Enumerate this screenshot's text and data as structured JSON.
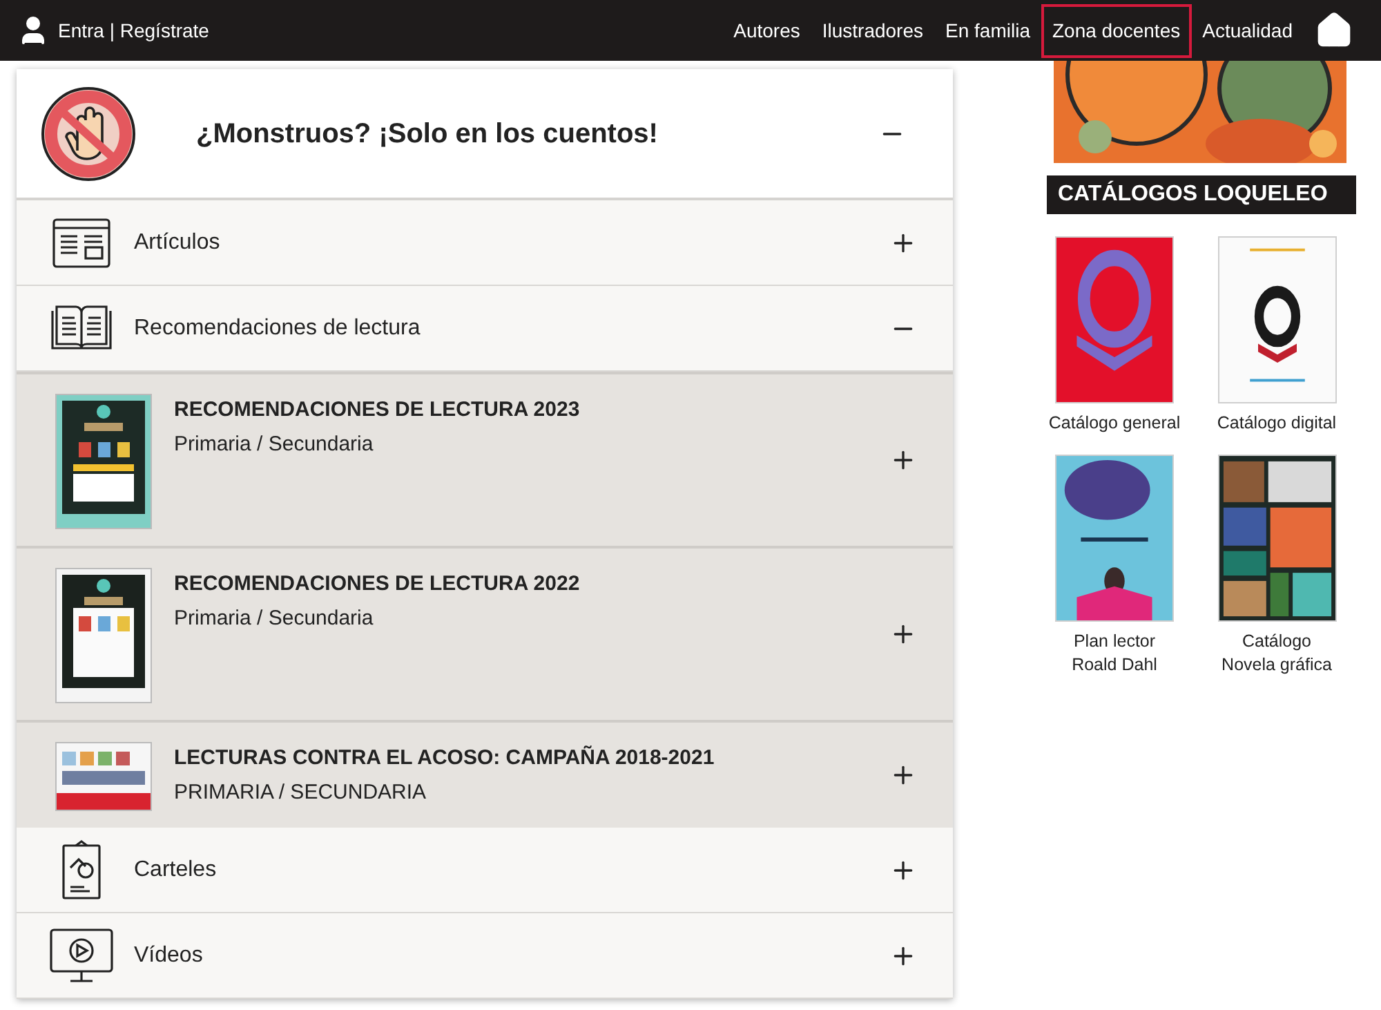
{
  "top_bar": {
    "account_link": "Entra | Regístrate",
    "nav": [
      {
        "label": "Autores",
        "selected": false
      },
      {
        "label": "Ilustradores",
        "selected": false
      },
      {
        "label": "En familia",
        "selected": false
      },
      {
        "label": "Zona docentes",
        "selected": true
      },
      {
        "label": "Actualidad",
        "selected": false
      }
    ]
  },
  "accordion": {
    "title": "¿Monstruos? ¡Solo en los cuentos!",
    "expanded": true,
    "sections": [
      {
        "label": "Artículos",
        "kind": "articles",
        "expanded": false
      },
      {
        "label": "Recomendaciones de lectura",
        "kind": "book",
        "expanded": true,
        "items": [
          {
            "title": "RECOMENDACIONES DE LECTURA 2023",
            "subtitle": "Primaria / Secundaria",
            "expanded": false
          },
          {
            "title": "RECOMENDACIONES DE LECTURA 2022",
            "subtitle": "Primaria / Secundaria",
            "expanded": false
          },
          {
            "title": "LECTURAS CONTRA EL ACOSO: CAMPAÑA 2018-2021",
            "subtitle": "PRIMARIA / SECUNDARIA",
            "expanded": false
          }
        ]
      },
      {
        "label": "Carteles",
        "kind": "poster",
        "expanded": false
      },
      {
        "label": "Vídeos",
        "kind": "video",
        "expanded": false
      }
    ]
  },
  "sidebar": {
    "catalogs_title": "CATÁLOGOS LOQUELEO",
    "catalogs": [
      {
        "lines": [
          "Catálogo general"
        ]
      },
      {
        "lines": [
          "Catálogo digital"
        ]
      },
      {
        "lines": [
          "Plan lector",
          "Roald Dahl"
        ]
      },
      {
        "lines": [
          "Catálogo",
          "Novela gráfica"
        ]
      }
    ]
  }
}
